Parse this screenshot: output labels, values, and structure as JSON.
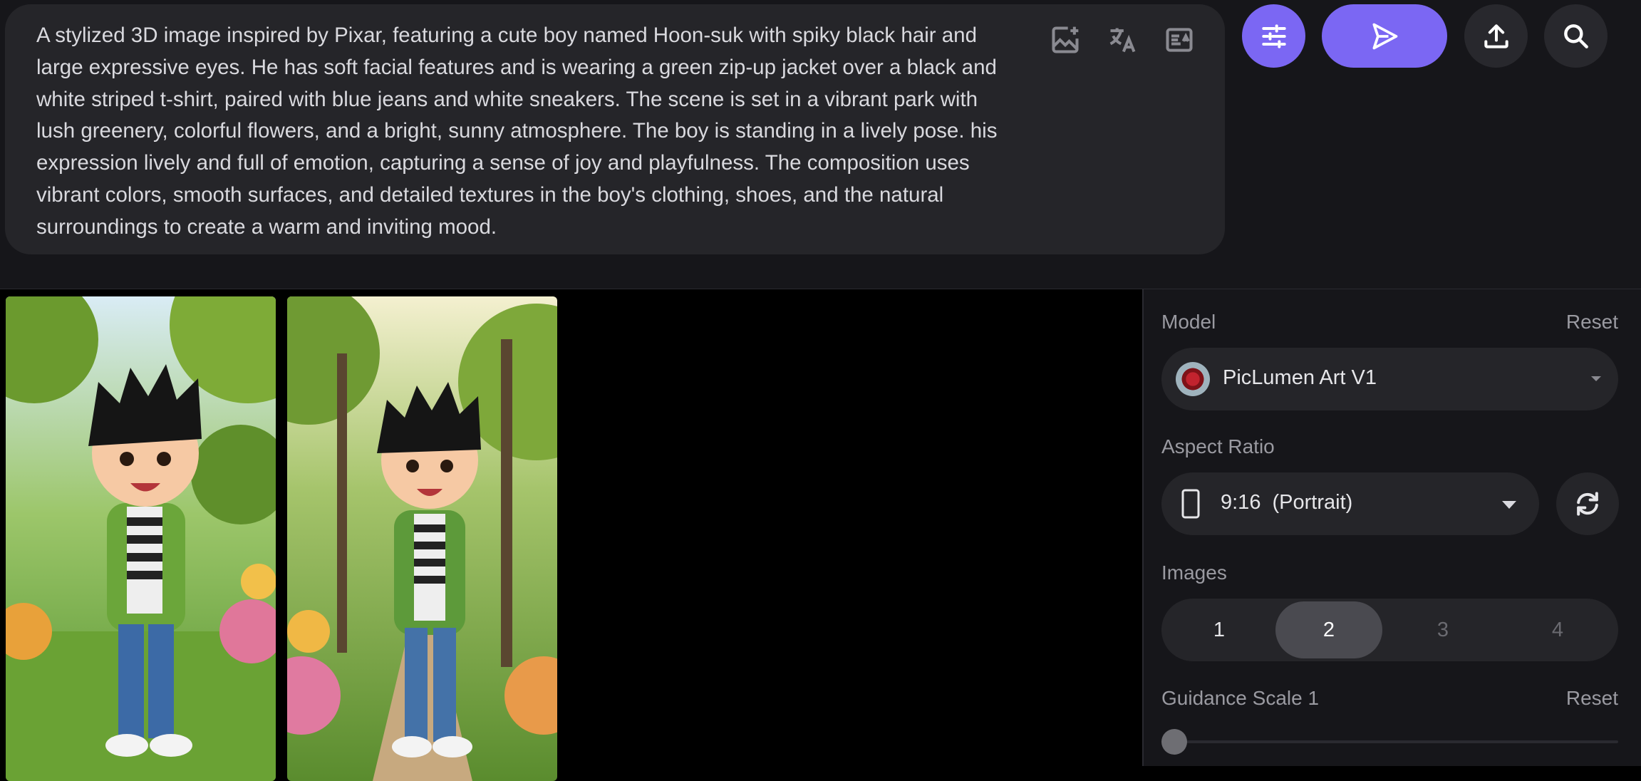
{
  "prompt": {
    "text": "A stylized 3D image inspired by Pixar, featuring a cute boy named Hoon-suk with spiky black hair and large expressive eyes. He has soft facial features and is wearing a green zip-up jacket over a black and white striped t-shirt, paired with blue jeans and white sneakers. The scene is set in a vibrant park with lush greenery, colorful flowers, and a bright, sunny atmosphere. The boy is standing in a lively pose. his expression lively and full of emotion, capturing a sense of joy and playfulness. The composition uses vibrant colors, smooth surfaces, and detailed textures in the boy's clothing, shoes, and the natural surroundings to create a warm and inviting mood.",
    "tools": [
      "add-image-icon",
      "translate-icon",
      "describe-icon"
    ]
  },
  "toolbar": {
    "settings_icon": "sliders-icon",
    "generate_icon": "send-icon",
    "upload_icon": "upload-icon",
    "search_icon": "search-icon",
    "accent": "#7b67f3"
  },
  "gallery": {
    "images": [
      {
        "alt_icon": "generated-image-1"
      },
      {
        "alt_icon": "generated-image-2"
      }
    ]
  },
  "panel": {
    "model_label": "Model",
    "model_reset": "Reset",
    "model_value": "PicLumen Art V1",
    "aspect_label": "Aspect Ratio",
    "aspect_value": "9:16  (Portrait)",
    "images_label": "Images",
    "image_counts": [
      "1",
      "2",
      "3",
      "4"
    ],
    "image_count_selected": "2",
    "guidance_label": "Guidance Scale 1",
    "guidance_reset": "Reset"
  }
}
